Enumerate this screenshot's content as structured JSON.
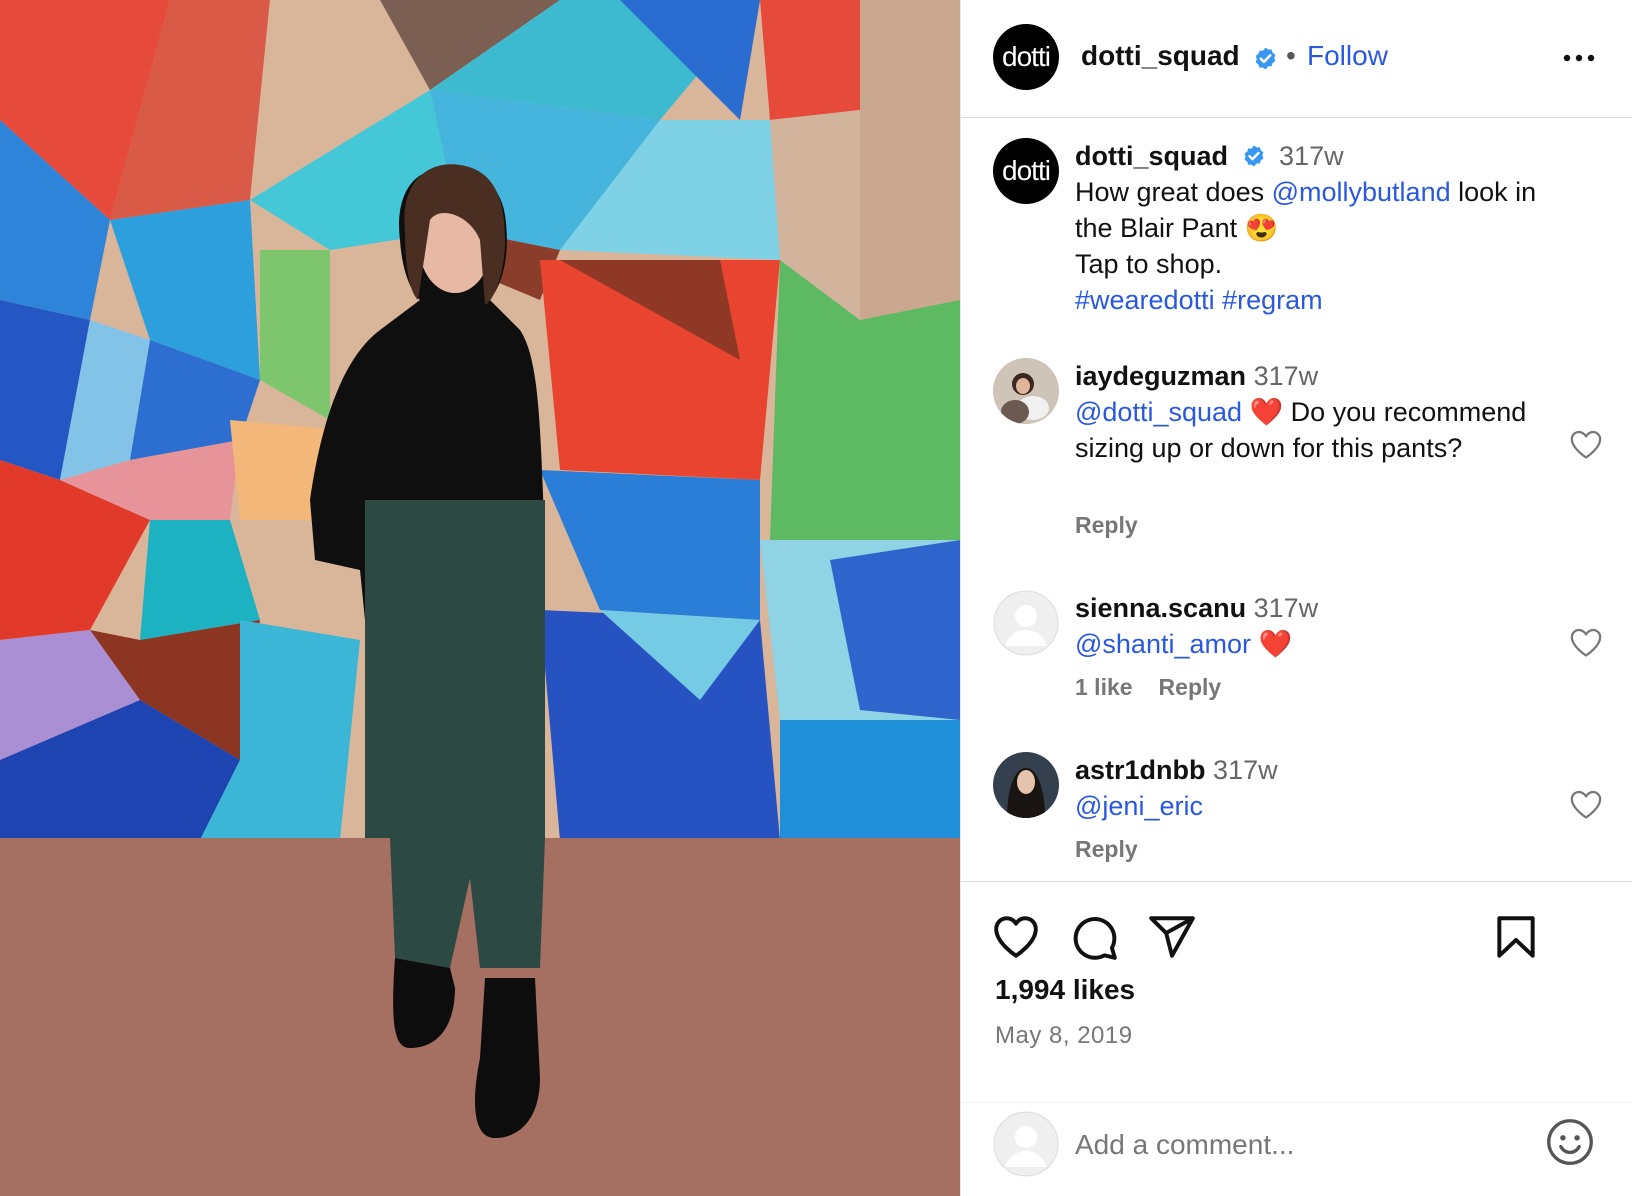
{
  "post_header": {
    "avatar_text": "dotti",
    "username": "dotti_squad",
    "separator": "•",
    "follow_label": "Follow"
  },
  "caption": {
    "avatar_text": "dotti",
    "username": "dotti_squad",
    "time": "317w",
    "text_before": "How great does ",
    "mention": "@mollybutland",
    "text_after": " look in the Blair Pant",
    "emoji": "😍",
    "line2": "Tap to shop.",
    "hashtags": "#wearedotti #regram"
  },
  "comments": [
    {
      "username": "iaydeguzman",
      "time": "317w",
      "mention": "@dotti_squad",
      "emoji": "❤️",
      "text": " Do you recommend sizing up or down for this pants?",
      "likes": "",
      "reply_label": "Reply"
    },
    {
      "username": "sienna.scanu",
      "time": "317w",
      "mention": "@shanti_amor",
      "emoji": "❤️",
      "text": "",
      "likes": "1 like",
      "reply_label": "Reply"
    },
    {
      "username": "astr1dnbb",
      "time": "317w",
      "mention": "@jeni_eric",
      "emoji": "",
      "text": "",
      "likes": "",
      "reply_label": "Reply"
    }
  ],
  "stats": {
    "likes": "1,994 likes",
    "date": "May 8, 2019"
  },
  "add_comment": {
    "placeholder": "Add a comment..."
  },
  "colors": {
    "link_blue": "#2a58e0",
    "verified_blue": "#3897f0",
    "heart_red": "#e0243a"
  },
  "icons": {
    "verified": "verified-badge-icon",
    "more": "more-dots-icon",
    "like": "heart-icon",
    "comment": "comment-bubble-icon",
    "share": "paper-plane-icon",
    "save": "bookmark-icon",
    "emoji": "emoji-smiley-icon"
  }
}
